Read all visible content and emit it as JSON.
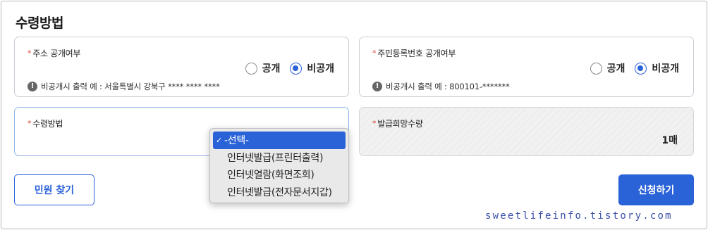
{
  "section_title": "수령방법",
  "address_card": {
    "label": "주소 공개여부",
    "options": [
      "공개",
      "비공개"
    ],
    "selected": "비공개",
    "notice": "비공개시 출력 예 : 서울특별시 강북구 **** **** ****"
  },
  "resident_card": {
    "label": "주민등록번호 공개여부",
    "options": [
      "공개",
      "비공개"
    ],
    "selected": "비공개",
    "notice": "비공개시 출력 예 : 800101-*******"
  },
  "method_card": {
    "label": "수령방법"
  },
  "quantity_card": {
    "label": "발급희망수량",
    "value": "1매"
  },
  "required_mark": "*",
  "dropdown": {
    "options": [
      "-선택-",
      "인터넷발급(프린터출력)",
      "인터넷열람(화면조회)",
      "인터넷발급(전자문서지갑)"
    ],
    "selected_index": 0,
    "check": "✓"
  },
  "buttons": {
    "find_civil": "민원 찾기",
    "apply": "신청하기"
  },
  "watermark": "sweetlifeinfo.tistory.com",
  "colors": {
    "accent": "#2a62d8",
    "required": "#e0453a",
    "watermark": "#3a4fa8"
  },
  "icons": {
    "notice": "info-icon",
    "checkmark": "check-icon"
  }
}
